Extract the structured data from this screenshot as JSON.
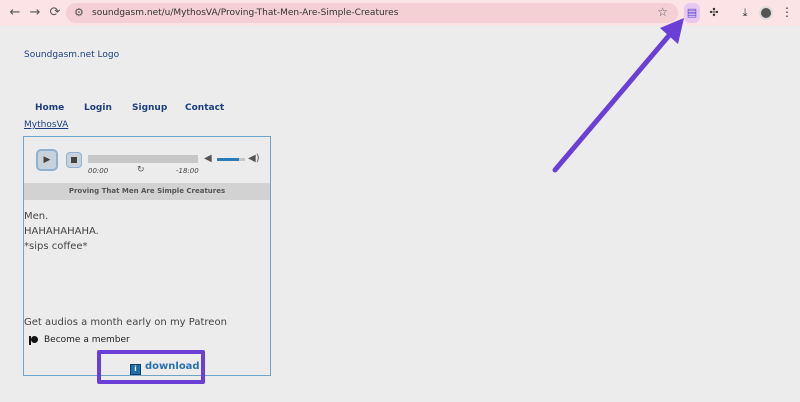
{
  "browser": {
    "url": "soundgasm.net/u/MythosVA/Proving-That-Men-Are-Simple-Creatures",
    "back_icon": "←",
    "forward_icon": "→",
    "reload_icon": "⟳",
    "site_info_icon": "⚙",
    "star_icon": "☆",
    "extension_icon": "▤",
    "puzzle_icon": "✣",
    "download_icon": "⤓"
  },
  "page": {
    "logo_text": "Soundgasm.net Logo",
    "nav": [
      "Home",
      "Login",
      "Signup",
      "Contact"
    ],
    "user_link": "MythosVA"
  },
  "player": {
    "play_icon": "▶",
    "time_elapsed": "00:00",
    "time_remaining": "-18:00",
    "loop_icon": "↻",
    "mute_icon": "◀",
    "volume_max_icon": "◀)",
    "volume_level": 0.8,
    "title": "Proving That Men Are Simple Creatures"
  },
  "description": {
    "lines": [
      "Men.",
      "HAHAHAHAHA.",
      "*sips coffee*"
    ],
    "patreon_text": "Get audios a month early on my Patreon",
    "become_member": "Become a member"
  },
  "download": {
    "label": "download",
    "icon_text": "i"
  },
  "colors": {
    "annotation": "#6a3fd6",
    "link": "#1d3f80"
  }
}
